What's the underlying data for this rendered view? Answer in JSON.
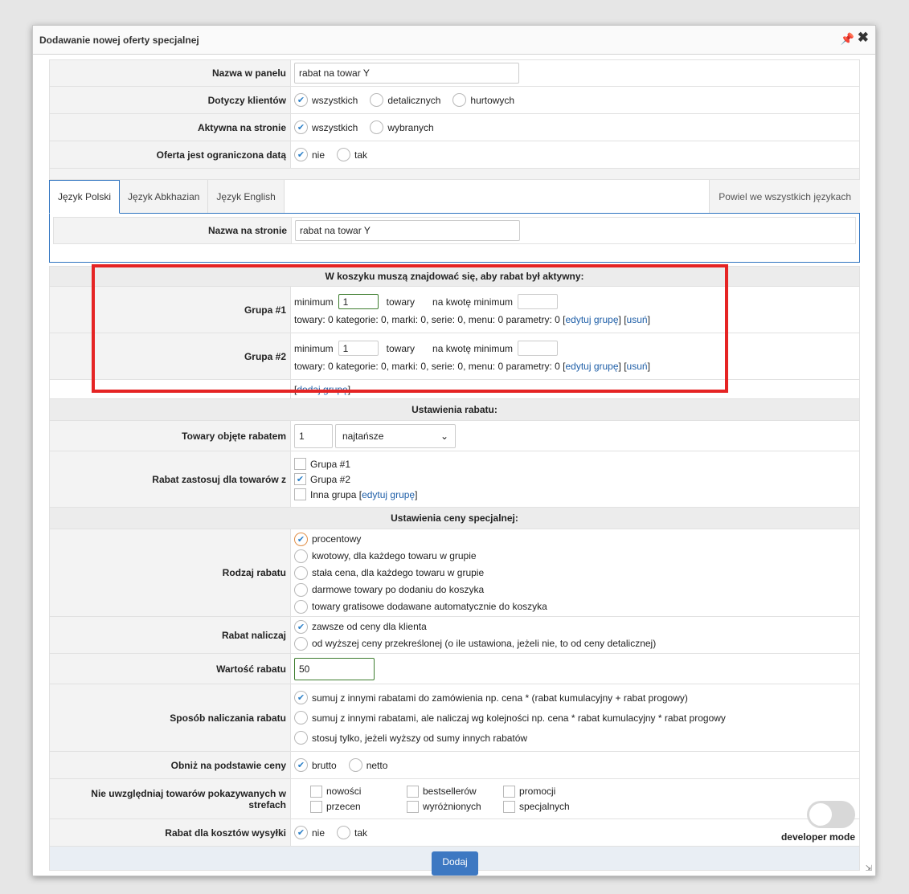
{
  "dialog": {
    "title": "Dodawanie nowej oferty specjalnej",
    "pin_icon": "pin-icon",
    "close_icon": "close-icon"
  },
  "fields": {
    "panel_name": {
      "label": "Nazwa w panelu",
      "value": "rabat na towar Y"
    },
    "clients": {
      "label": "Dotyczy klientów",
      "options": [
        "wszystkich",
        "detalicznych",
        "hurtowych"
      ],
      "selected": 0
    },
    "active": {
      "label": "Aktywna na stronie",
      "options": [
        "wszystkich",
        "wybranych"
      ],
      "selected": 0
    },
    "date_limited": {
      "label": "Oferta jest ograniczona datą",
      "options": [
        "nie",
        "tak"
      ],
      "selected": 0
    }
  },
  "tabs": {
    "items": [
      "Język Polski",
      "Język Abkhazian",
      "Język English"
    ],
    "active": 0,
    "repeat": "Powiel we wszystkich językach",
    "site_name": {
      "label": "Nazwa na stronie",
      "value": "rabat na towar Y"
    }
  },
  "cart": {
    "header": "W koszyku muszą znajdować się, aby rabat był aktywny:",
    "groups": [
      {
        "label": "Grupa #1",
        "minimum_label": "minimum",
        "minimum": "1",
        "unit": "towary",
        "amount_label": "na kwotę minimum",
        "amount": "",
        "summary": "towary: 0 kategorie: 0, marki: 0, serie: 0, menu: 0 parametry: 0",
        "edit": "edytuj grupę",
        "remove": "usuń"
      },
      {
        "label": "Grupa #2",
        "minimum_label": "minimum",
        "minimum": "1",
        "unit": "towary",
        "amount_label": "na kwotę minimum",
        "amount": "",
        "summary": "towary: 0 kategorie: 0, marki: 0, serie: 0, menu: 0 parametry: 0",
        "edit": "edytuj grupę",
        "remove": "usuń"
      }
    ],
    "add_group": "dodaj grupę"
  },
  "discount_settings": {
    "header": "Ustawienia rabatu:",
    "products_covered": {
      "label": "Towary objęte rabatem",
      "count": "1",
      "select": "najtańsze"
    },
    "apply_for": {
      "label": "Rabat zastosuj dla towarów z",
      "options": [
        "Grupa #1",
        "Grupa #2",
        "Inna grupa"
      ],
      "checked": [
        false,
        true,
        false
      ],
      "edit": "edytuj grupę"
    }
  },
  "price_settings": {
    "header": "Ustawienia ceny specjalnej:",
    "type": {
      "label": "Rodzaj rabatu",
      "options": [
        "procentowy",
        "kwotowy, dla każdego towaru w grupie",
        "stała cena, dla każdego towaru w grupie",
        "darmowe towary po dodaniu do koszyka",
        "towary gratisowe dodawane automatycznie do koszyka"
      ],
      "selected": 0
    },
    "calc_from": {
      "label": "Rabat naliczaj",
      "options": [
        "zawsze od ceny dla klienta",
        "od wyższej ceny przekreślonej (o ile ustawiona, jeżeli nie, to od ceny detalicznej)"
      ],
      "selected": 0
    },
    "value": {
      "label": "Wartość rabatu",
      "value": "50"
    },
    "method": {
      "label": "Sposób naliczania rabatu",
      "options": [
        "sumuj z innymi rabatami do zamówienia np. cena * (rabat kumulacyjny + rabat progowy)",
        "sumuj z innymi rabatami, ale naliczaj wg kolejności np. cena * rabat kumulacyjny * rabat progowy",
        "stosuj tylko, jeżeli wyższy od sumy innych rabatów"
      ],
      "selected": 0
    },
    "basis": {
      "label": "Obniż na podstawie ceny",
      "options": [
        "brutto",
        "netto"
      ],
      "selected": 0
    },
    "exclude": {
      "label": "Nie uwzględniaj towarów pokazywanych w strefach",
      "zones": [
        "nowości",
        "bestsellerów",
        "promocji",
        "przecen",
        "wyróżnionych",
        "specjalnych"
      ]
    },
    "shipping": {
      "label": "Rabat dla kosztów wysyłki",
      "options": [
        "nie",
        "tak"
      ],
      "selected": 0
    }
  },
  "developer_mode": {
    "label": "developer mode"
  },
  "submit": {
    "label": "Dodaj"
  }
}
